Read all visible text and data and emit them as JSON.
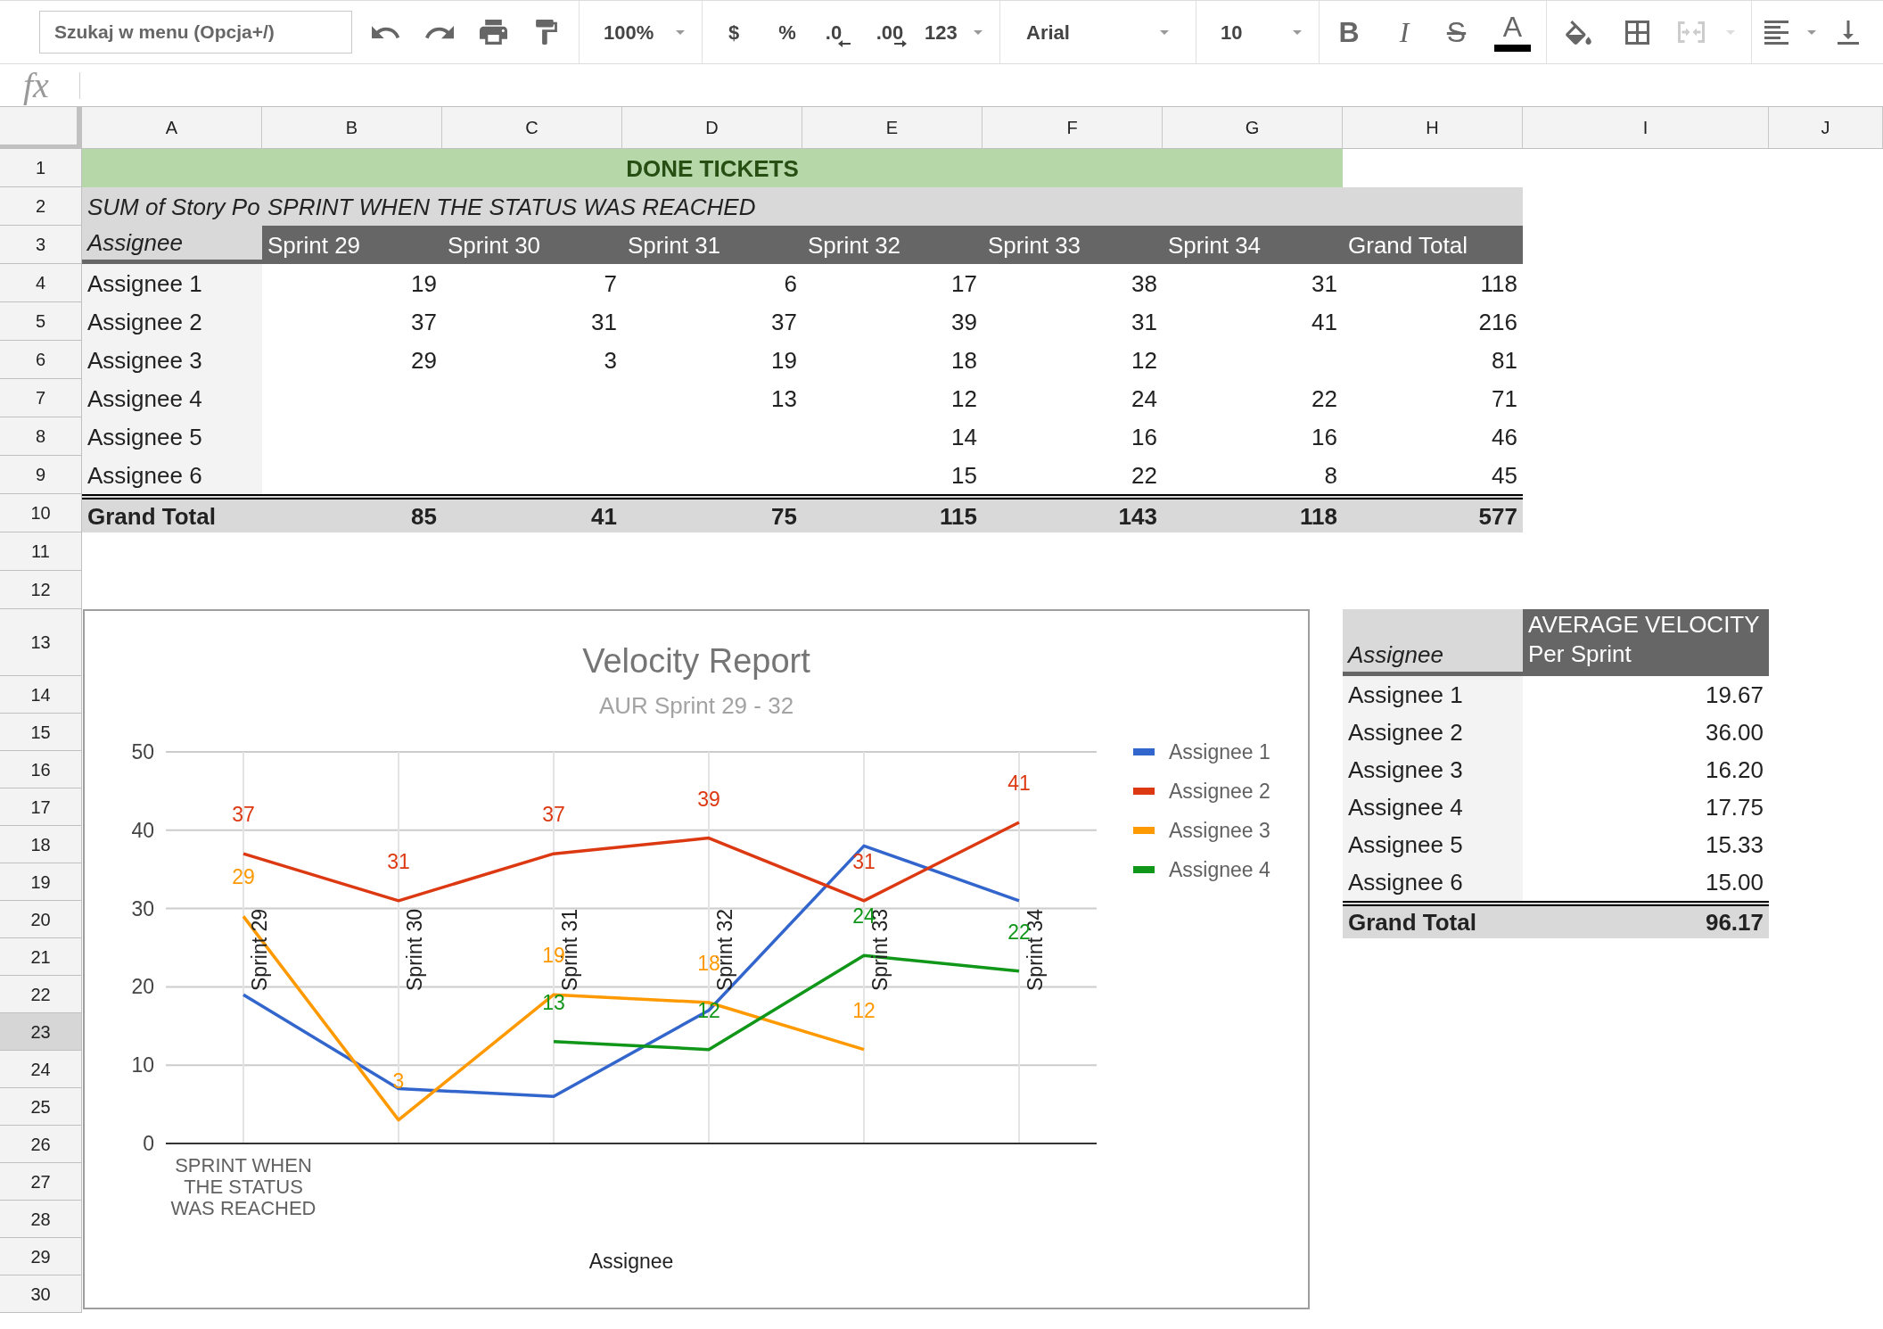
{
  "toolbar": {
    "search": {
      "placeholder": "Szukaj w menu (Opcja+/)"
    },
    "zoom": "100%",
    "number_formats": [
      {
        "label": "$",
        "kind": "currency"
      },
      {
        "label": "%",
        "kind": "percent"
      },
      {
        "label": ".0",
        "kind": "decrease"
      },
      {
        "label": ".00",
        "kind": "increase"
      },
      {
        "label": "123",
        "kind": "more"
      }
    ],
    "font": "Arial",
    "font_size": "10",
    "text_styles": [
      {
        "label": "B",
        "kind": "bold"
      },
      {
        "label": "I",
        "kind": "italic"
      },
      {
        "label": "S",
        "kind": "strikethrough"
      },
      {
        "label": "A",
        "kind": "color"
      }
    ],
    "merge": {
      "disabled": true
    }
  },
  "formula_bar": {
    "label": "fx"
  },
  "column_headers": [
    {
      "label": "A",
      "selected": false
    },
    {
      "label": "B",
      "selected": false
    },
    {
      "label": "C",
      "selected": false
    },
    {
      "label": "D",
      "selected": false
    },
    {
      "label": "E",
      "selected": false
    },
    {
      "label": "F",
      "selected": false
    },
    {
      "label": "G",
      "selected": false
    },
    {
      "label": "H",
      "selected": false
    },
    {
      "label": "I",
      "selected": false
    },
    {
      "label": "J",
      "selected": false
    }
  ],
  "row_headers": [
    {
      "label": "1",
      "selected": false
    },
    {
      "label": "2",
      "selected": false
    },
    {
      "label": "3",
      "selected": false
    },
    {
      "label": "4",
      "selected": false
    },
    {
      "label": "5",
      "selected": false
    },
    {
      "label": "6",
      "selected": false
    },
    {
      "label": "7",
      "selected": false
    },
    {
      "label": "8",
      "selected": false
    },
    {
      "label": "9",
      "selected": false
    },
    {
      "label": "10",
      "selected": false
    },
    {
      "label": "11",
      "selected": false
    },
    {
      "label": "12",
      "selected": false
    },
    {
      "label": "13",
      "selected": false
    },
    {
      "label": "14",
      "selected": false
    },
    {
      "label": "15",
      "selected": false
    },
    {
      "label": "16",
      "selected": false
    },
    {
      "label": "17",
      "selected": false
    },
    {
      "label": "18",
      "selected": false
    },
    {
      "label": "19",
      "selected": false
    },
    {
      "label": "20",
      "selected": false
    },
    {
      "label": "21",
      "selected": false
    },
    {
      "label": "22",
      "selected": false
    },
    {
      "label": "23",
      "selected": true
    },
    {
      "label": "24",
      "selected": false
    },
    {
      "label": "25",
      "selected": false
    },
    {
      "label": "26",
      "selected": false
    },
    {
      "label": "27",
      "selected": false
    },
    {
      "label": "28",
      "selected": false
    },
    {
      "label": "29",
      "selected": false
    },
    {
      "label": "30",
      "selected": false
    }
  ],
  "pivot_table": {
    "title": "DONE TICKETS",
    "value_label": "SUM of Story Po",
    "column_field": "SPRINT WHEN THE STATUS WAS REACHED",
    "row_field": "Assignee",
    "columns": [
      "Sprint 29",
      "Sprint 30",
      "Sprint 31",
      "Sprint 32",
      "Sprint 33",
      "Sprint 34",
      "Grand Total"
    ],
    "rows": [
      {
        "label": "Assignee 1",
        "cells": [
          "19",
          "7",
          "6",
          "17",
          "38",
          "31",
          "118"
        ]
      },
      {
        "label": "Assignee 2",
        "cells": [
          "37",
          "31",
          "37",
          "39",
          "31",
          "41",
          "216"
        ]
      },
      {
        "label": "Assignee 3",
        "cells": [
          "29",
          "3",
          "19",
          "18",
          "12",
          null,
          "81"
        ]
      },
      {
        "label": "Assignee 4",
        "cells": [
          null,
          null,
          "13",
          "12",
          "24",
          "22",
          "71"
        ]
      },
      {
        "label": "Assignee 5",
        "cells": [
          null,
          null,
          null,
          "14",
          "16",
          "16",
          "46"
        ]
      },
      {
        "label": "Assignee 6",
        "cells": [
          null,
          null,
          null,
          "15",
          "22",
          "8",
          "45"
        ]
      }
    ],
    "total": {
      "label": "Grand Total",
      "cells": [
        "85",
        "41",
        "75",
        "115",
        "143",
        "118",
        "577"
      ]
    }
  },
  "average_table": {
    "row_field": "Assignee",
    "value_header": "AVERAGE VELOCITY\nPer Sprint",
    "rows": [
      {
        "label": "Assignee 1",
        "value": "19.67"
      },
      {
        "label": "Assignee 2",
        "value": "36.00"
      },
      {
        "label": "Assignee 3",
        "value": "16.20"
      },
      {
        "label": "Assignee 4",
        "value": "17.75"
      },
      {
        "label": "Assignee 5",
        "value": "15.33"
      },
      {
        "label": "Assignee 6",
        "value": "15.00"
      }
    ],
    "total": {
      "label": "Grand Total",
      "value": "96.17"
    }
  },
  "chart": {
    "chart_data": {
      "type": "line",
      "title": "Velocity Report",
      "subtitle": "AUR Sprint 29 - 32",
      "xlabel": "Assignee",
      "categories": [
        "Sprint 29",
        "Sprint 30",
        "Sprint 31",
        "Sprint 32",
        "Sprint 33",
        "Sprint 34"
      ],
      "ylim": [
        0,
        50
      ],
      "yticks": [
        0,
        10,
        20,
        30,
        40,
        50
      ],
      "grid": true,
      "legend": "right",
      "series": [
        {
          "name": "Assignee 1",
          "color": "#3366cc",
          "values": [
            19,
            7,
            6,
            17,
            38,
            31
          ],
          "data_labels": false
        },
        {
          "name": "Assignee 2",
          "color": "#dc3912",
          "values": [
            37,
            31,
            37,
            39,
            31,
            41
          ],
          "data_labels": true
        },
        {
          "name": "Assignee 3",
          "color": "#ff9900",
          "values": [
            29,
            3,
            19,
            18,
            12,
            null
          ],
          "data_labels": true
        },
        {
          "name": "Assignee 4",
          "color": "#109618",
          "values": [
            null,
            null,
            13,
            12,
            24,
            22
          ],
          "data_labels": true
        }
      ],
      "annotations": [
        "SPRINT WHEN THE STATUS WAS REACHED"
      ]
    }
  }
}
